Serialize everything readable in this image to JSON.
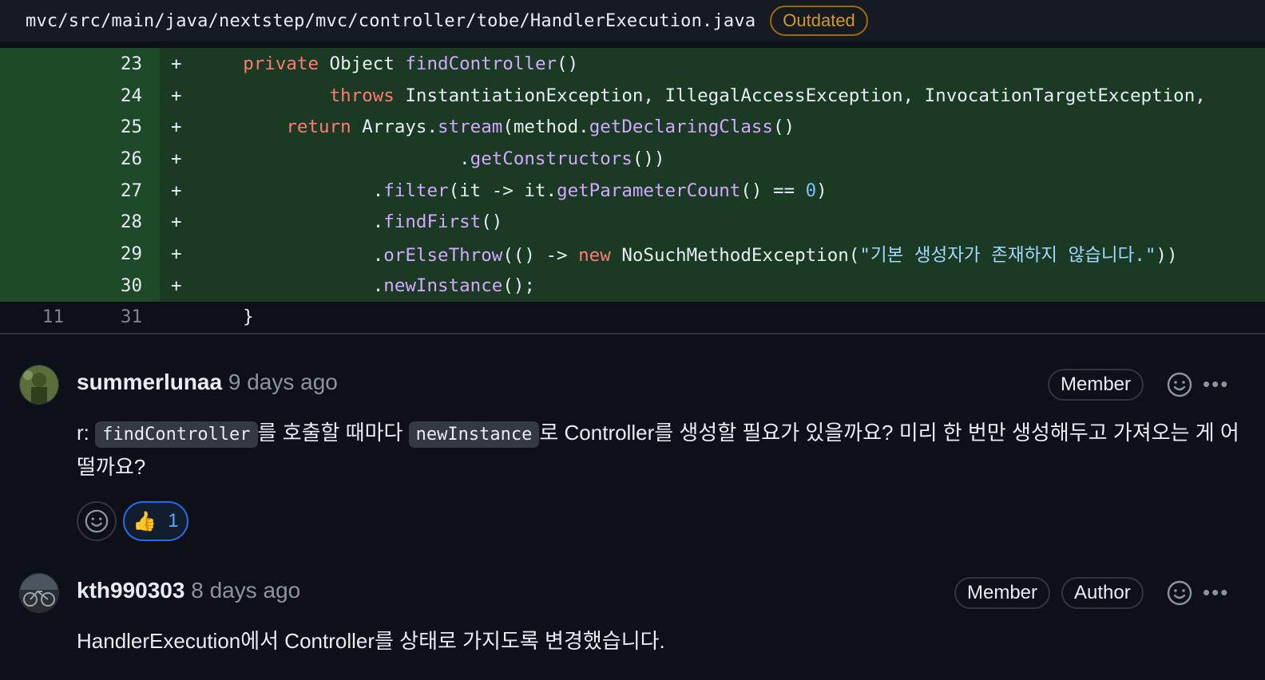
{
  "file": {
    "path": "mvc/src/main/java/nextstep/mvc/controller/tobe/HandlerExecution.java",
    "status_badge": "Outdated"
  },
  "diff_lines": [
    {
      "old": "",
      "new": "23",
      "marker": "+",
      "tokens": [
        {
          "t": "    "
        },
        {
          "t": "private",
          "c": "kw"
        },
        {
          "t": " Object "
        },
        {
          "t": "findController",
          "c": "fn"
        },
        {
          "t": "()"
        }
      ]
    },
    {
      "old": "",
      "new": "24",
      "marker": "+",
      "tokens": [
        {
          "t": "            "
        },
        {
          "t": "throws",
          "c": "kw"
        },
        {
          "t": " InstantiationException, IllegalAccessException, InvocationTargetException,"
        }
      ]
    },
    {
      "old": "",
      "new": "25",
      "marker": "+",
      "tokens": [
        {
          "t": "        "
        },
        {
          "t": "return",
          "c": "kw"
        },
        {
          "t": " Arrays."
        },
        {
          "t": "stream",
          "c": "fn"
        },
        {
          "t": "(method."
        },
        {
          "t": "getDeclaringClass",
          "c": "fn"
        },
        {
          "t": "()"
        }
      ]
    },
    {
      "old": "",
      "new": "26",
      "marker": "+",
      "tokens": [
        {
          "t": "                        ."
        },
        {
          "t": "getConstructors",
          "c": "fn"
        },
        {
          "t": "())"
        }
      ]
    },
    {
      "old": "",
      "new": "27",
      "marker": "+",
      "tokens": [
        {
          "t": "                ."
        },
        {
          "t": "filter",
          "c": "fn"
        },
        {
          "t": "(it -> it."
        },
        {
          "t": "getParameterCount",
          "c": "fn"
        },
        {
          "t": "() == "
        },
        {
          "t": "0",
          "c": "num"
        },
        {
          "t": ")"
        }
      ]
    },
    {
      "old": "",
      "new": "28",
      "marker": "+",
      "tokens": [
        {
          "t": "                ."
        },
        {
          "t": "findFirst",
          "c": "fn"
        },
        {
          "t": "()"
        }
      ]
    },
    {
      "old": "",
      "new": "29",
      "marker": "+",
      "tokens": [
        {
          "t": "                ."
        },
        {
          "t": "orElseThrow",
          "c": "fn"
        },
        {
          "t": "(() -> "
        },
        {
          "t": "new",
          "c": "kw"
        },
        {
          "t": " NoSuchMethodException("
        },
        {
          "t": "\"기본 생성자가 존재하지 않습니다.\"",
          "c": "str"
        },
        {
          "t": "))"
        }
      ]
    },
    {
      "old": "",
      "new": "30",
      "marker": "+",
      "tokens": [
        {
          "t": "                ."
        },
        {
          "t": "newInstance",
          "c": "fn"
        },
        {
          "t": "();"
        }
      ]
    },
    {
      "old": "11",
      "new": "31",
      "marker": "",
      "tokens": [
        {
          "t": "    }"
        }
      ]
    }
  ],
  "comments": [
    {
      "author": "summerlunaa",
      "time": "9 days ago",
      "badges": [
        "Member"
      ],
      "body_prefix": "r: ",
      "code1": "findController",
      "body_mid": "를 호출할 때마다 ",
      "code2": "newInstance",
      "body_suffix": "로 Controller를 생성할 필요가 있을까요? 미리 한 번만 생성해두고 가져오는 게 어떨까요?",
      "reaction_emoji": "👍",
      "reaction_count": "1",
      "icons": [
        "smiley-icon",
        "kebab-menu-icon"
      ]
    },
    {
      "author": "kth990303",
      "time": "8 days ago",
      "badges": [
        "Member",
        "Author"
      ],
      "body": "HandlerExecution에서 Controller를 상태로 가지도록 변경했습니다.",
      "icons": [
        "smiley-icon",
        "kebab-menu-icon"
      ]
    }
  ],
  "colors": {
    "background": "#0d1117",
    "added_line": "#1a3a23",
    "keyword": "#ff7b72",
    "function": "#d2a8ff",
    "string": "#a5d6ff",
    "outdated": "#d29922",
    "reaction_border": "#1f6feb"
  }
}
